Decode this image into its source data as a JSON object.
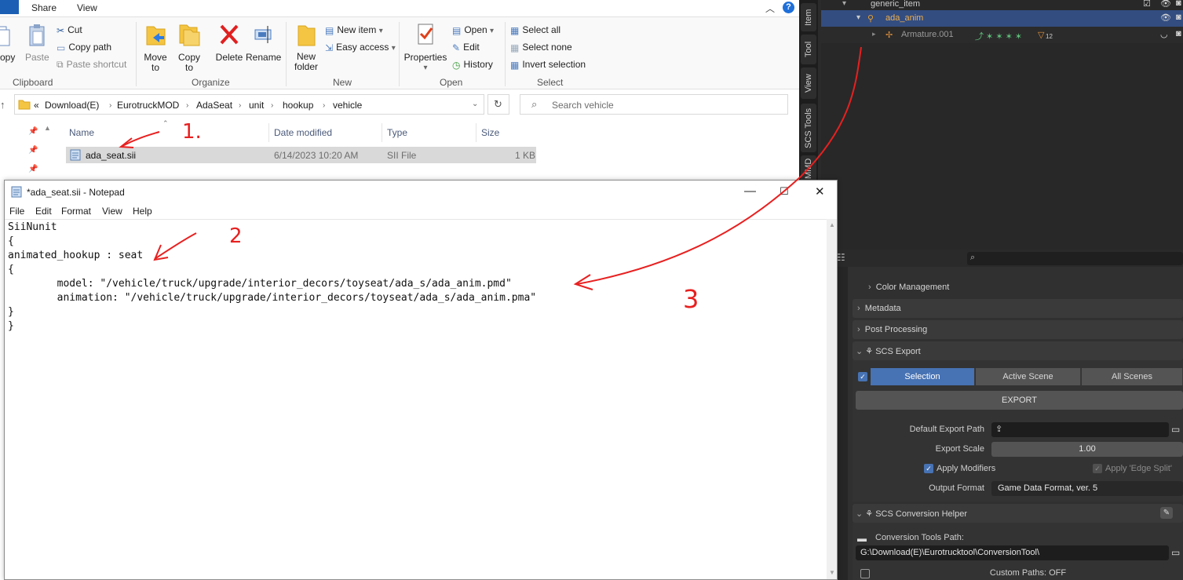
{
  "explorer": {
    "tabs": [
      "Share",
      "View"
    ],
    "file_tab": "",
    "ribbon": {
      "clipboard": {
        "group": "Clipboard",
        "copy": "opy",
        "paste": "Paste",
        "cut": "Cut",
        "copy_path": "Copy path",
        "paste_shortcut": "Paste shortcut"
      },
      "organize": {
        "group": "Organize",
        "move_to": "Move to",
        "copy_to": "Copy to",
        "delete": "Delete",
        "rename": "Rename"
      },
      "new": {
        "group": "New",
        "new_folder_1": "New",
        "new_folder_2": "folder",
        "new_item": "New item",
        "easy_access": "Easy access"
      },
      "open": {
        "group": "Open",
        "properties": "Properties",
        "open": "Open",
        "edit": "Edit",
        "history": "History"
      },
      "select": {
        "group": "Select",
        "select_all": "Select all",
        "select_none": "Select none",
        "invert_selection": "Invert selection"
      }
    },
    "address": {
      "overflow": "«",
      "crumbs": [
        "Download(E)",
        "EurotruckMOD",
        "AdaSeat",
        "unit",
        "hookup",
        "vehicle"
      ]
    },
    "search": {
      "placeholder": "Search vehicle"
    },
    "columns": [
      "Name",
      "Date modified",
      "Type",
      "Size"
    ],
    "files": [
      {
        "name": "ada_seat.sii",
        "date": "6/14/2023 10:20 AM",
        "type": "SII File",
        "size": "1 KB"
      }
    ]
  },
  "notepad": {
    "title": "*ada_seat.sii - Notepad",
    "menu": [
      "File",
      "Edit",
      "Format",
      "View",
      "Help"
    ],
    "lines": [
      "SiiNunit",
      "{",
      "animated_hookup : seat",
      "{",
      "        model: \"/vehicle/truck/upgrade/interior_decors/toyseat/ada_s/ada_anim.pmd\"",
      "        animation: \"/vehicle/truck/upgrade/interior_decors/toyseat/ada_s/ada_anim.pma\"",
      "}",
      "}"
    ]
  },
  "blender": {
    "side_tabs": [
      "Item",
      "Tool",
      "View",
      "SCS Tools",
      "MMD"
    ],
    "outliner": [
      {
        "label": "generic_item"
      },
      {
        "label": "ada_anim"
      },
      {
        "label": "Armature.001",
        "badge": "12"
      }
    ],
    "properties": {
      "color_management": "Color Management",
      "metadata": "Metadata",
      "post_processing": "Post Processing",
      "scs_export": "SCS Export",
      "export_modes": [
        "Selection",
        "Active Scene",
        "All Scenes"
      ],
      "export_button": "EXPORT",
      "default_export_path_label": "Default Export Path",
      "export_scale_label": "Export Scale",
      "export_scale_value": "1.00",
      "apply_modifiers": "Apply Modifiers",
      "apply_edge_split": "Apply 'Edge Split'",
      "output_format_label": "Output Format",
      "output_format_value": "Game Data Format, ver. 5",
      "conversion_helper": "SCS Conversion Helper",
      "conversion_tools_path_label": "Conversion Tools Path:",
      "conversion_tools_path_value": "G:\\Download(E)\\Eurotrucktool\\ConversionTool\\",
      "custom_paths": "Custom Paths: OFF"
    }
  },
  "annotations": [
    "1.",
    "2",
    "3"
  ],
  "colors": {
    "accent": "#4772b3",
    "annotation": "#e82020",
    "blender_bg": "#303030"
  }
}
